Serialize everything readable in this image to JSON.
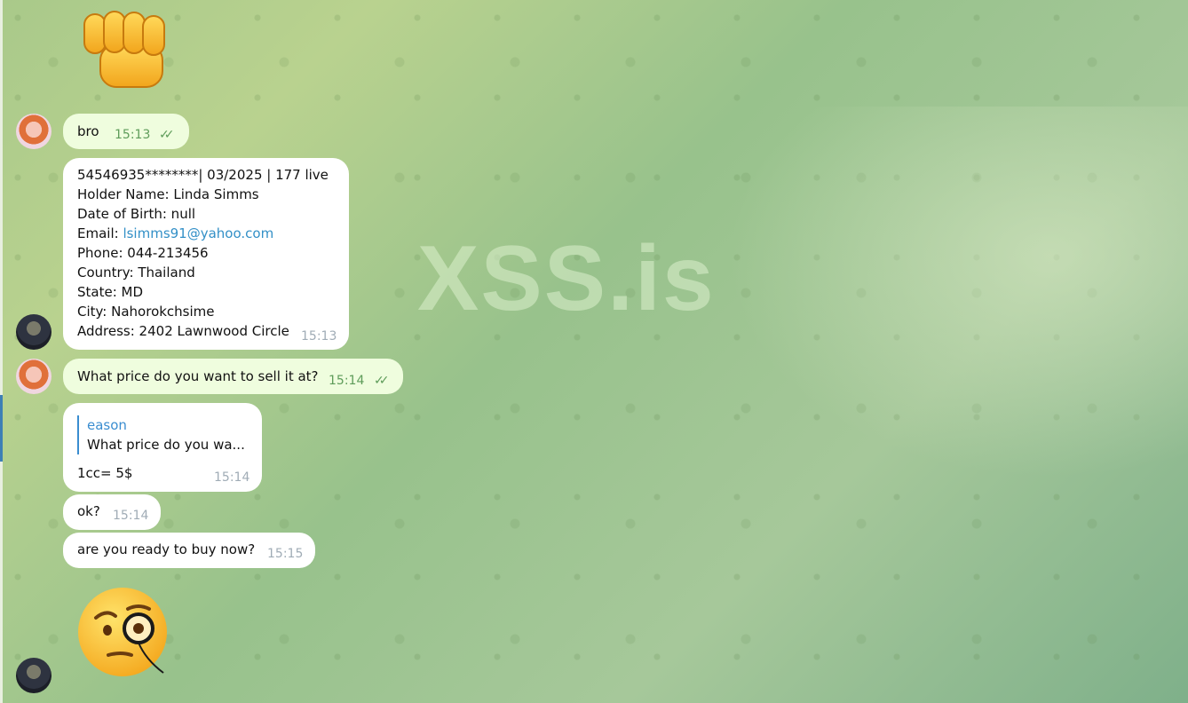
{
  "watermark": "XSS.is",
  "messages": {
    "m1": {
      "text": "bro",
      "time": "15:13",
      "status": "✓✓"
    },
    "m2": {
      "lines": [
        "54546935********| 03/2025 | 177 live",
        "Holder Name: Linda Simms",
        "Date of Birth: null"
      ],
      "email_label": "Email: ",
      "email": "lsimms91@yahoo.com",
      "lines2": [
        "Phone: 044-213456",
        "Country: Thailand",
        "State: MD",
        "City: Nahorokchsime",
        "Address: 2402 Lawnwood Circle"
      ],
      "time": "15:13"
    },
    "m3": {
      "text": "What price do you want to sell it at?",
      "time": "15:14",
      "status": "✓✓"
    },
    "m4": {
      "quote_author": "eason",
      "quote_text": "What price do you wa...",
      "text": "1cc= 5$",
      "time": "15:14"
    },
    "m5": {
      "text": "ok?",
      "time": "15:14"
    },
    "m6": {
      "text": "are you ready to buy now?",
      "time": "15:15"
    }
  },
  "stickers": {
    "top": "fist-bump-emoji",
    "bottom": "face-with-monocle-emoji"
  },
  "colors": {
    "outgoing": "#effdde",
    "incoming": "#ffffff",
    "link": "#3390c7",
    "quote_bar": "#3a8dd0"
  }
}
